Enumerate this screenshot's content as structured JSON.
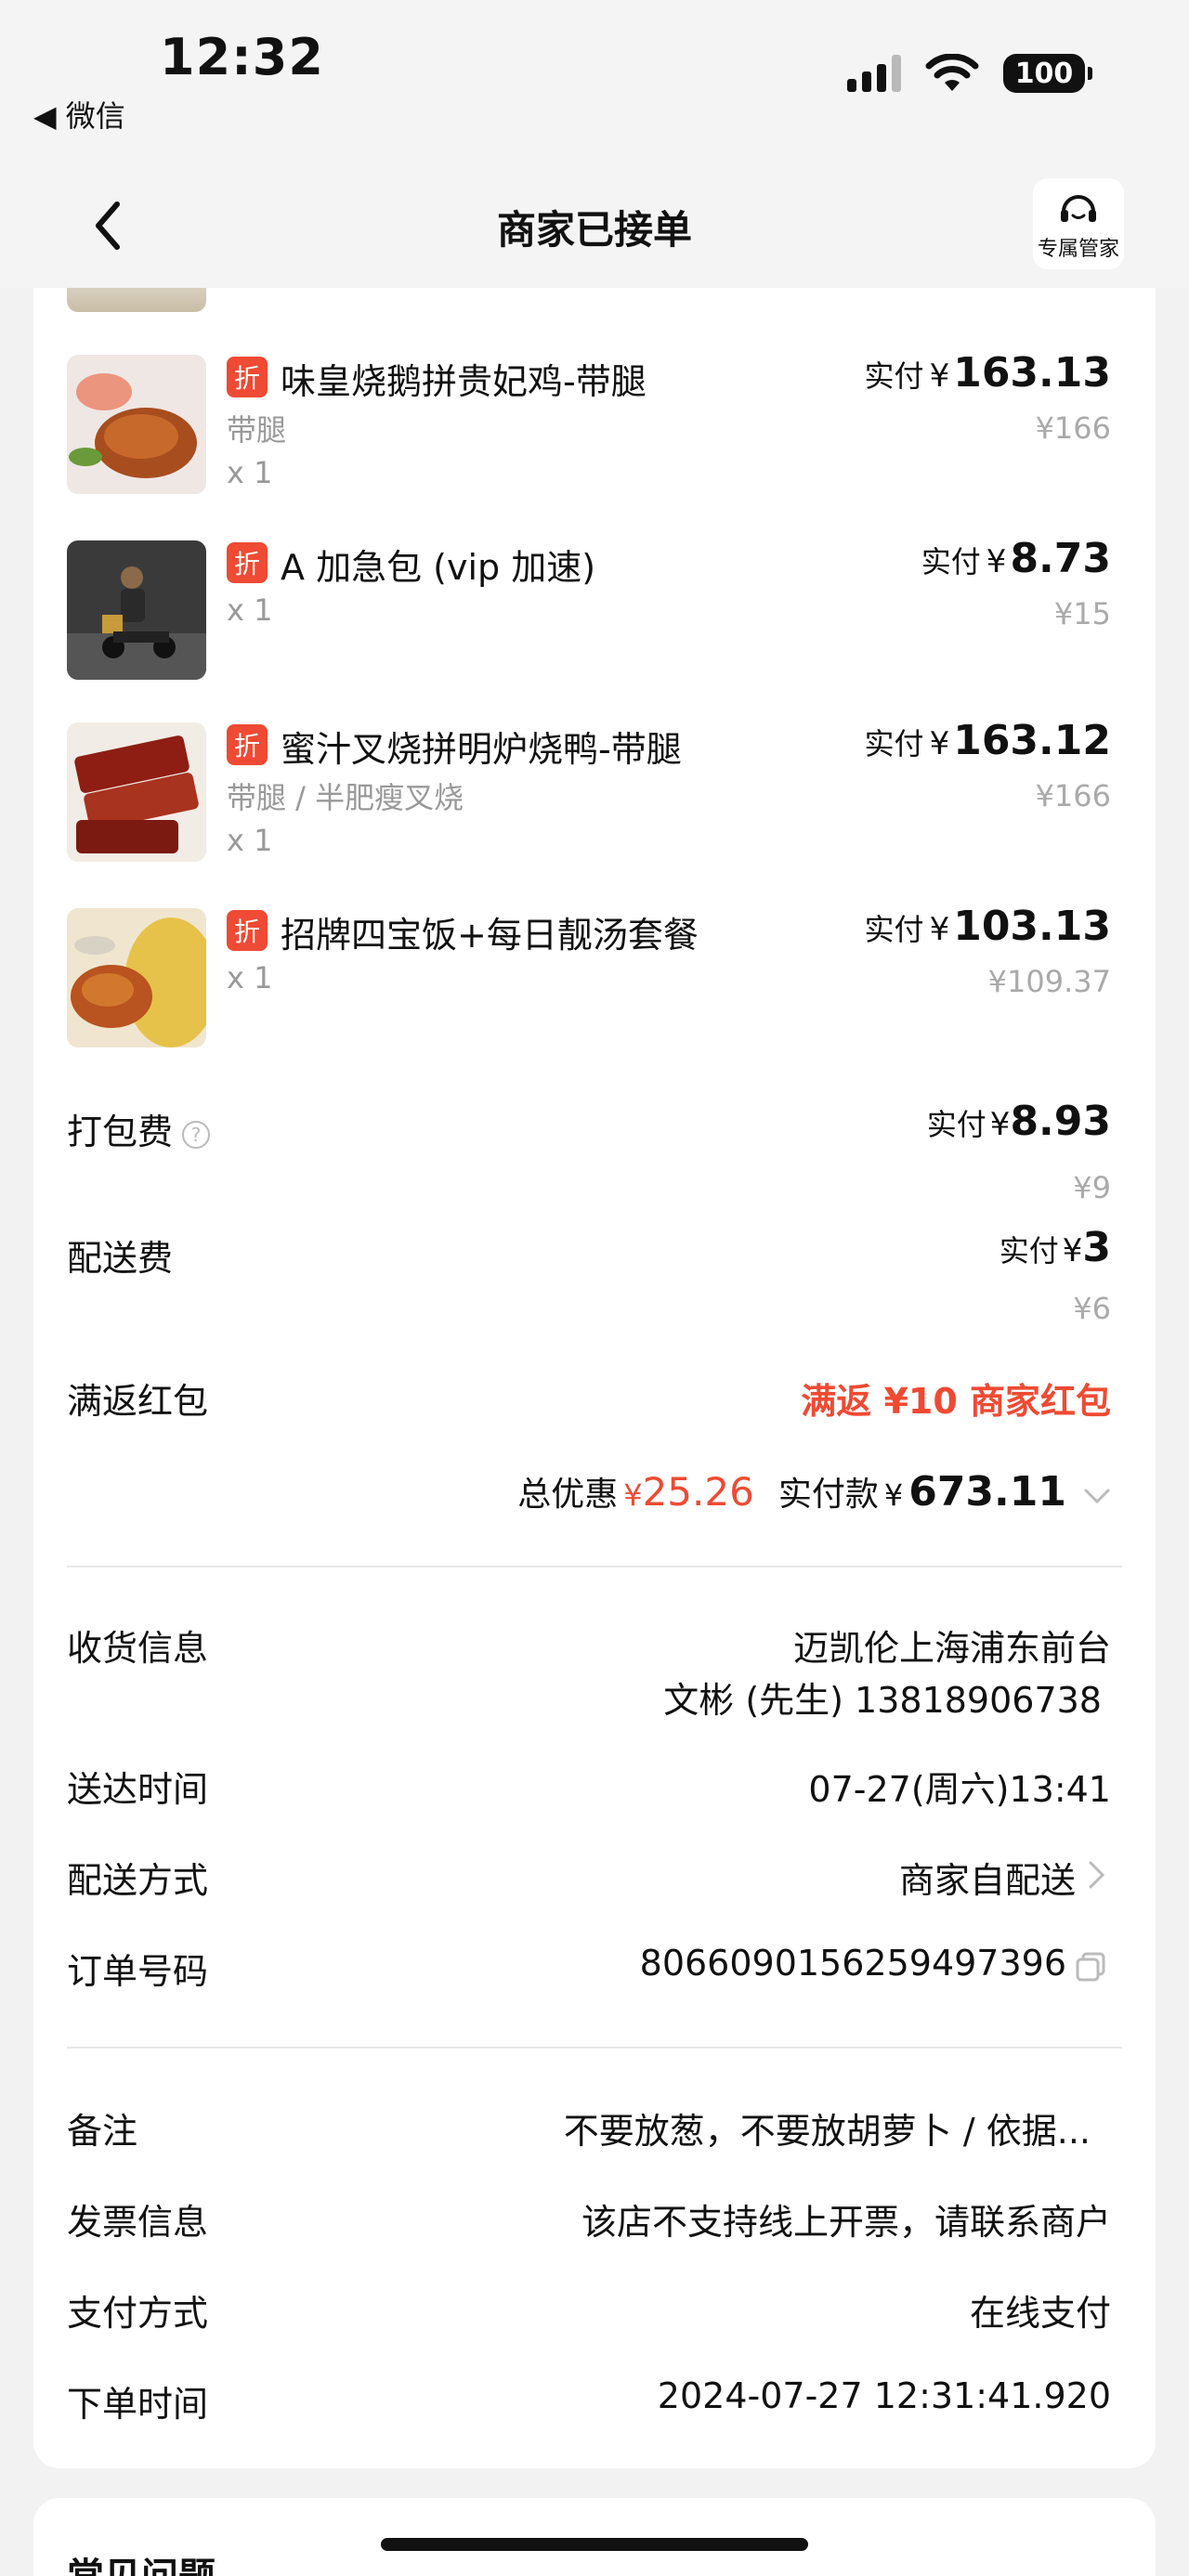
{
  "status_bar": {
    "time": "12:32",
    "back_app": "◀ 微信",
    "battery": "100"
  },
  "nav": {
    "title": "商家已接单",
    "service_label": "专属管家"
  },
  "items": [
    {
      "name": "味皇烧鹅拼贵妃鸡-带腿",
      "badge": "折",
      "spec": "带腿",
      "qty": "x 1",
      "paid_label": "实付",
      "currency": "¥",
      "paid": "163.13",
      "original": "¥166",
      "thumb": "roast-goose"
    },
    {
      "name": "A 加急包 (vip 加速)",
      "badge": "折",
      "spec": "",
      "qty": "x 1",
      "paid_label": "实付",
      "currency": "¥",
      "paid": "8.73",
      "original": "¥15",
      "thumb": "delivery-rider"
    },
    {
      "name": "蜜汁叉烧拼明炉烧鸭-带腿",
      "badge": "折",
      "spec": "带腿 / 半肥瘦叉烧",
      "qty": "x 1",
      "paid_label": "实付",
      "currency": "¥",
      "paid": "163.12",
      "original": "¥166",
      "thumb": "char-siu"
    },
    {
      "name": "招牌四宝饭+每日靓汤套餐",
      "badge": "折",
      "spec": "",
      "qty": "x 1",
      "paid_label": "实付",
      "currency": "¥",
      "paid": "103.13",
      "original": "¥109.37",
      "thumb": "rice-soup"
    }
  ],
  "fees": {
    "packing": {
      "label": "打包费",
      "help": "?",
      "paid_label": "实付",
      "currency": "¥",
      "paid": "8.93",
      "original": "¥9"
    },
    "delivery": {
      "label": "配送费",
      "paid_label": "实付",
      "currency": "¥",
      "paid": "3",
      "original": "¥6"
    },
    "red_packet": {
      "label": "满返红包",
      "value": "满返 ¥10 商家红包"
    }
  },
  "totals": {
    "discount_label": "总优惠",
    "discount_currency": "¥",
    "discount": "25.26",
    "paid_label": "实付款",
    "paid_currency": "¥",
    "paid": "673.11"
  },
  "delivery_info": {
    "address_label": "收货信息",
    "address_line1": "迈凯伦上海浦东前台",
    "address_line2": "文彬 (先生) 13818906738",
    "time_label": "送达时间",
    "time_value": "07-27(周六)13:41",
    "method_label": "配送方式",
    "method_value": "商家自配送",
    "order_label": "订单号码",
    "order_value": "8066090156259497396"
  },
  "extra_info": {
    "note_label": "备注",
    "note_value": "不要放葱，不要放胡萝卜 / 依据...",
    "invoice_label": "发票信息",
    "invoice_value": "该店不支持线上开票，请联系商户",
    "payment_label": "支付方式",
    "payment_value": "在线支付",
    "order_time_label": "下单时间",
    "order_time_value": "2024-07-27 12:31:41.920"
  },
  "faq": {
    "title": "常见问题"
  },
  "colors": {
    "accent_red": "#ef4a33",
    "page_bg": "#f2f2f2",
    "muted": "#999999"
  }
}
